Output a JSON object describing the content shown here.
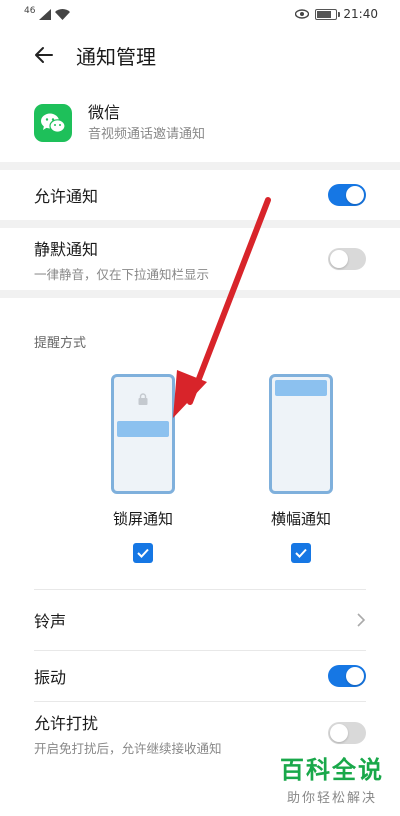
{
  "statusbar": {
    "signal": "46",
    "time": "21:40"
  },
  "appbar": {
    "title": "通知管理"
  },
  "app": {
    "name": "微信",
    "description": "音视频通话邀请通知"
  },
  "allow": {
    "label": "允许通知",
    "enabled": true
  },
  "silent": {
    "label": "静默通知",
    "sub": "一律静音，仅在下拉通知栏显示",
    "enabled": false
  },
  "reminder": {
    "label": "提醒方式",
    "modes": [
      {
        "label": "锁屏通知",
        "checked": true
      },
      {
        "label": "横幅通知",
        "checked": true
      }
    ]
  },
  "ringtone": {
    "label": "铃声"
  },
  "vibrate": {
    "label": "振动",
    "enabled": true
  },
  "dnd": {
    "label": "允许打扰",
    "sub": "开启免打扰后，允许继续接收通知",
    "enabled": false
  },
  "watermark": {
    "title": "百科全说",
    "subtitle": "助你轻松解决"
  },
  "colors": {
    "accent": "#1677e4",
    "arrow": "#d8242a",
    "brand": "#19a84a",
    "wechat": "#1ec05a"
  }
}
